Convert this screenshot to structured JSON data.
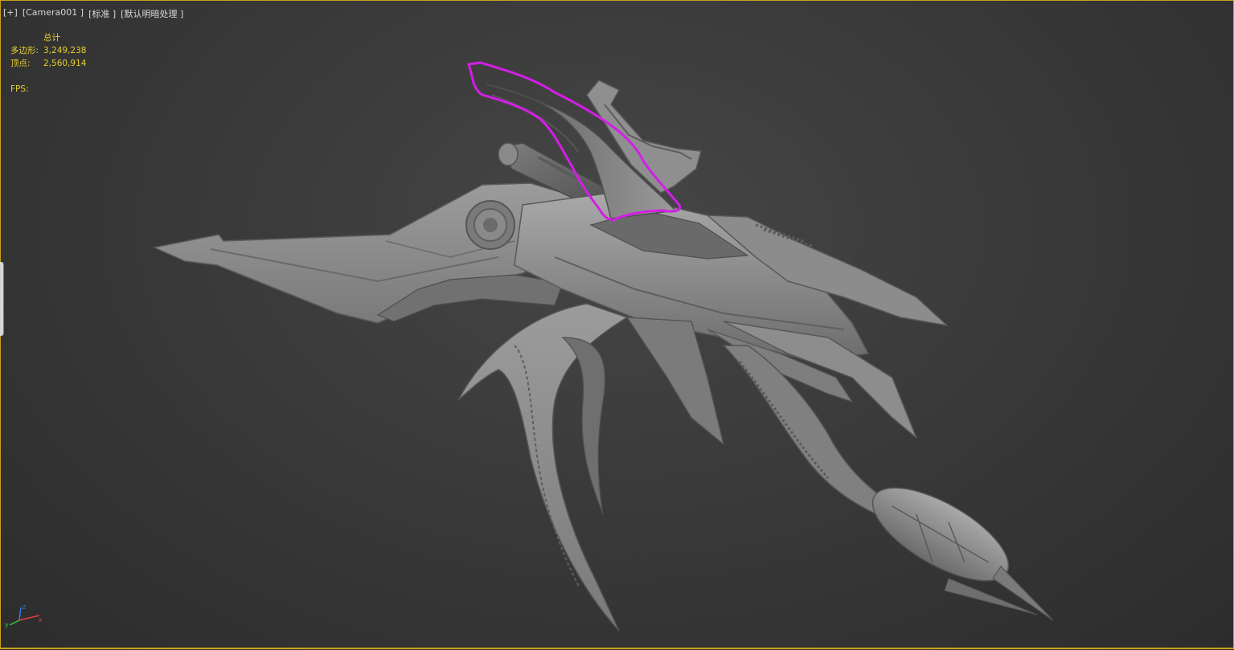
{
  "viewport": {
    "labels": [
      "[+]",
      "[Camera001 ]",
      "[标准 ]",
      "[默认明暗处理 ]"
    ]
  },
  "stats": {
    "header": "总计",
    "polygons_label": "多边形:",
    "polygons_value": "3,249,238",
    "vertices_label": "顶点:",
    "vertices_value": "2,560,914",
    "fps_label": "FPS:"
  },
  "colors": {
    "viewport_border": "#c8a21a",
    "stats_text": "#e6cf34",
    "highlight_stroke": "#d41ee6",
    "model_base": "#8e8e8e"
  },
  "gizmo": {
    "axes": [
      "x",
      "y",
      "z"
    ]
  }
}
